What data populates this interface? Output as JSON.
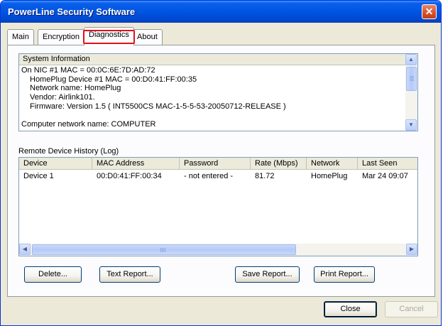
{
  "window": {
    "title": "PowerLine Security Software",
    "close_glyph": "✕"
  },
  "tabs": [
    {
      "label": "Main"
    },
    {
      "label": "Encryption"
    },
    {
      "label": "Diagnostics"
    },
    {
      "label": "About"
    }
  ],
  "active_tab": "Diagnostics",
  "system_info": {
    "header": "System Information",
    "lines": [
      "On NIC #1 MAC = 00:0C:6E:7D:AD:72",
      "HomePlug Device #1 MAC = 00:D0:41:FF:00:35",
      "Network name: HomePlug",
      "Vendor: Airlink101.",
      "Firmware: Version 1.5   ( INT5500CS MAC-1-5-5-53-20050712-RELEASE )",
      "",
      "Computer network name: COMPUTER"
    ]
  },
  "remote_history": {
    "label": "Remote Device History (Log)",
    "columns": [
      "Device",
      "MAC Address",
      "Password",
      "Rate (Mbps)",
      "Network",
      "Last Seen"
    ],
    "rows": [
      [
        "Device 1",
        "00:D0:41:FF:00:34",
        "- not entered -",
        "81.72",
        "HomePlug",
        "Mar 24 09:07"
      ]
    ]
  },
  "buttons": {
    "delete": "Delete...",
    "text_report": "Text Report...",
    "save_report": "Save Report...",
    "print_report": "Print Report...",
    "close": "Close",
    "cancel": "Cancel"
  },
  "icons": {
    "scroll_up": "▲",
    "scroll_down": "▼",
    "scroll_left": "◀",
    "scroll_right": "▶"
  },
  "colors": {
    "titlebar": "#0054e3",
    "tab_focus": "#e3101a",
    "face": "#ece9d8"
  }
}
